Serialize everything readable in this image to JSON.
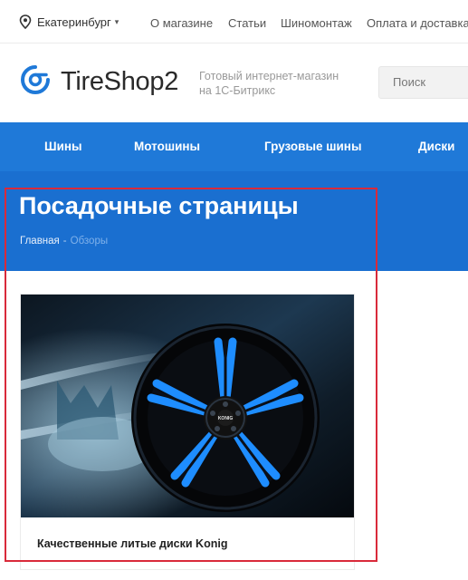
{
  "topbar": {
    "city": "Екатеринбург",
    "links": [
      "О магазине",
      "Статьи",
      "Шиномонтаж",
      "Оплата и доставка"
    ]
  },
  "header": {
    "logo_text": "TireShop2",
    "slogan_line1": "Готовый интернет-магазин",
    "slogan_line2": "на 1С-Битрикс",
    "search_placeholder": "Поиск"
  },
  "nav": {
    "items": [
      "Шины",
      "Мотошины",
      "Грузовые шины",
      "Диски"
    ]
  },
  "hero": {
    "title": "Посадочные страницы",
    "breadcrumb": {
      "home": "Главная",
      "separator": "-",
      "current": "Обзоры"
    }
  },
  "card": {
    "title": "Качественные литые диски Konig",
    "wheel_badge": "KONIG"
  },
  "colors": {
    "brand_blue": "#1f79d8",
    "hero_blue": "#1a6fd0",
    "highlight_red": "#d92a3a"
  },
  "icons": {
    "city": "map-pin-icon",
    "city_caret": "caret-down-icon",
    "logo": "brand-logo-icon"
  }
}
